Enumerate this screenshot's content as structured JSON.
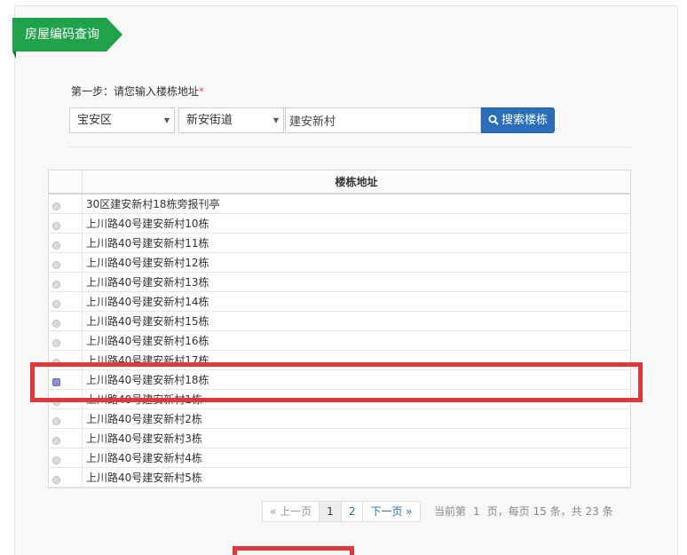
{
  "header": {
    "tab_title": "房屋编码查询"
  },
  "step": {
    "label": "第一步：请您输入楼栋地址",
    "required_mark": "*"
  },
  "filters": {
    "district": "宝安区",
    "street": "新安街道",
    "address_value": "建安新村",
    "search_label": "搜索楼栋"
  },
  "table": {
    "header": "楼栋地址",
    "rows": [
      {
        "address": "30区建安新村18栋旁报刊亭",
        "selected": false
      },
      {
        "address": "上川路40号建安新村10栋",
        "selected": false
      },
      {
        "address": "上川路40号建安新村11栋",
        "selected": false
      },
      {
        "address": "上川路40号建安新村12栋",
        "selected": false
      },
      {
        "address": "上川路40号建安新村13栋",
        "selected": false
      },
      {
        "address": "上川路40号建安新村14栋",
        "selected": false
      },
      {
        "address": "上川路40号建安新村15栋",
        "selected": false
      },
      {
        "address": "上川路40号建安新村16栋",
        "selected": false
      },
      {
        "address": "上川路40号建安新村17栋",
        "selected": false
      },
      {
        "address": "上川路40号建安新村18栋",
        "selected": true
      },
      {
        "address": "上川路40号建安新村1栋",
        "selected": false
      },
      {
        "address": "上川路40号建安新村2栋",
        "selected": false
      },
      {
        "address": "上川路40号建安新村3栋",
        "selected": false
      },
      {
        "address": "上川路40号建安新村4栋",
        "selected": false
      },
      {
        "address": "上川路40号建安新村5栋",
        "selected": false
      }
    ]
  },
  "pagination": {
    "prev": "« 上一页",
    "page1": "1",
    "page2": "2",
    "next": "下一页 »",
    "current_prefix": "当前第",
    "current_page": "1",
    "per_page_text": "页，每页",
    "per_page": "15",
    "total_text": "条，共",
    "total": "23",
    "total_suffix": "条"
  },
  "colors": {
    "ribbon": "#20a24b",
    "primary_button": "#2a6ebb",
    "highlight_box": "#e0383a"
  }
}
